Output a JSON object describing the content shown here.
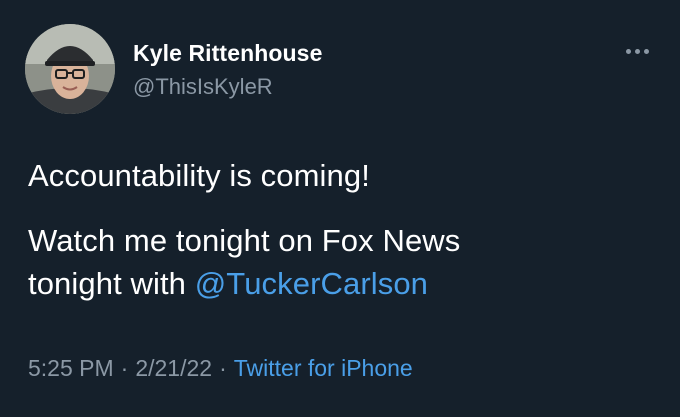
{
  "author": {
    "display_name": "Kyle Rittenhouse",
    "handle": "@ThisIsKyleR",
    "avatar_icon": "profile-photo"
  },
  "more_icon": "more-horizontal-icon",
  "tweet": {
    "line1": "Accountability is coming!",
    "line2": "Watch me tonight on Fox News",
    "line3_prefix": "tonight with ",
    "mention": "@TuckerCarlson"
  },
  "meta": {
    "time": "5:25 PM",
    "separator": "·",
    "date": "2/21/22",
    "source": "Twitter for iPhone"
  },
  "colors": {
    "background": "#15202b",
    "text": "#ffffff",
    "secondary_text": "#8b98a5",
    "link": "#4a9fe8"
  }
}
